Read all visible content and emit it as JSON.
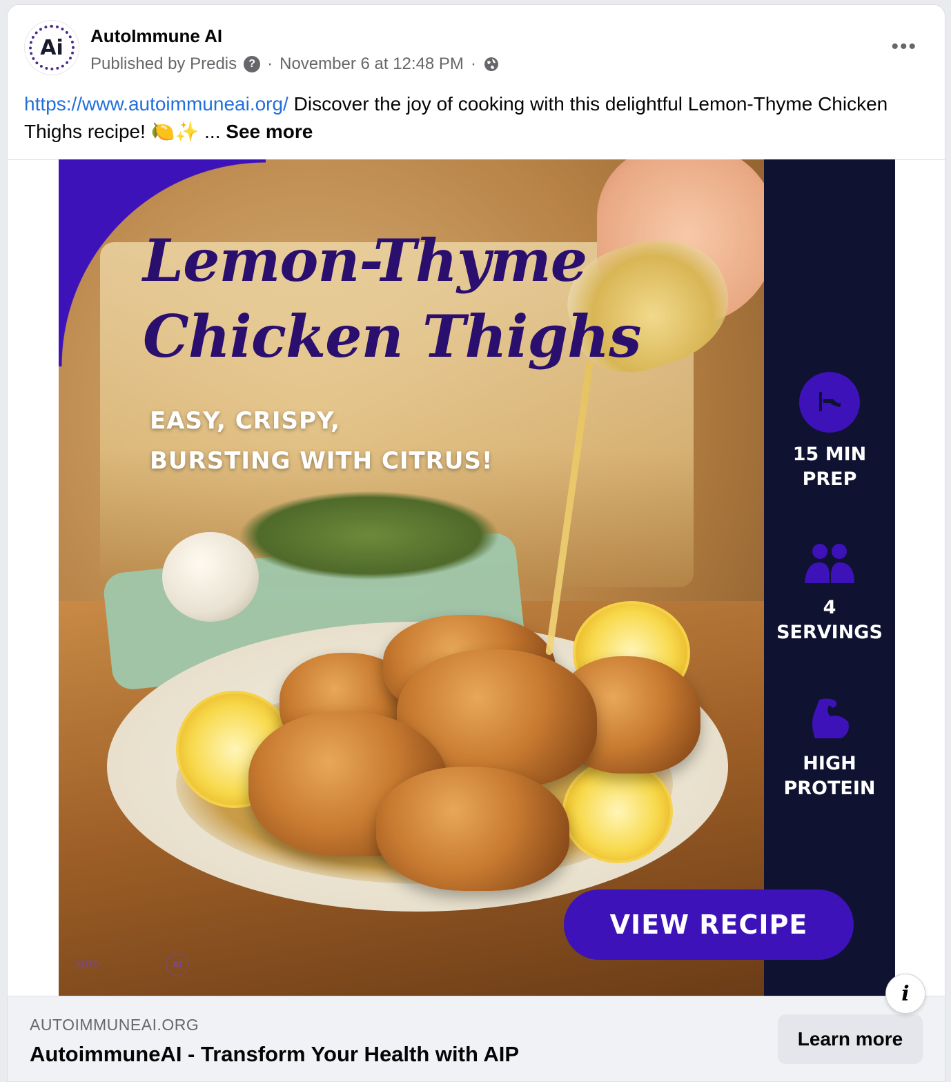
{
  "post": {
    "page_name": "AutoImmune AI",
    "avatar_text": "Ai",
    "published_by": "Published by Predis",
    "separator": "·",
    "timestamp": "November 6 at 12:48 PM",
    "more_icon": "•••",
    "link_text": "https://www.autoimmuneai.org/",
    "body_text": " Discover the joy of cooking with this delightful Lemon-Thyme Chicken Thighs recipe! 🍋✨ ... ",
    "see_more": "See more"
  },
  "ad_image": {
    "title_line1": "Lemon-Thyme",
    "title_line2": "Chicken Thighs",
    "tagline_line1": "EASY, CRISPY,",
    "tagline_line2": "BURSTING WITH CITRUS!",
    "features": [
      {
        "icon": "clock-icon",
        "line1": "15 MIN",
        "line2": "PREP"
      },
      {
        "icon": "people-icon",
        "line1": "4",
        "line2": "SERVINGS"
      },
      {
        "icon": "muscle-icon",
        "line1": "HIGH",
        "line2": "PROTEIN"
      }
    ],
    "button_label": "VIEW RECIPE",
    "watermark": "AUTO",
    "watermark_ai": "AI",
    "colors": {
      "accent_purple": "#3d12b9",
      "sidebar_navy": "#0f1230",
      "title_purple": "#2a0f6e"
    }
  },
  "info_icon": "i",
  "link_preview": {
    "domain": "AUTOIMMUNEAI.ORG",
    "headline": "AutoimmuneAI - Transform Your Health with AIP",
    "cta": "Learn more"
  }
}
